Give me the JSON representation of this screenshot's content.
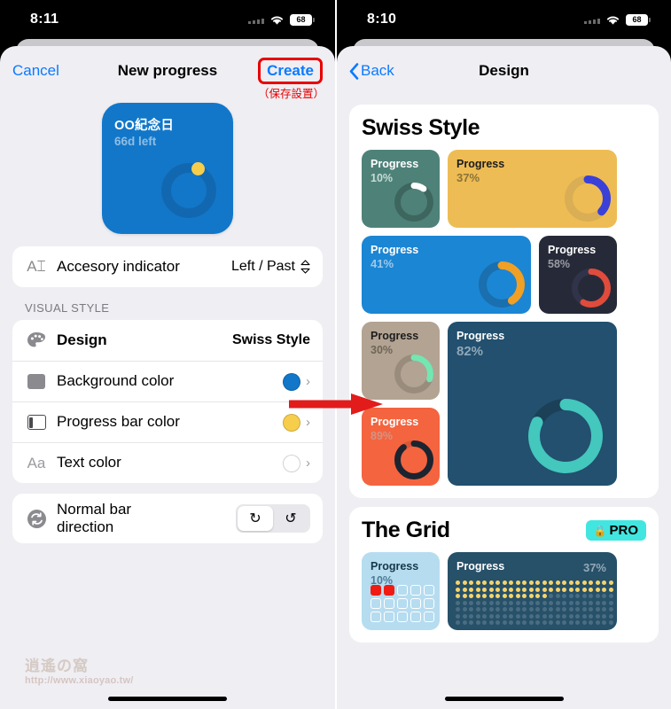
{
  "left_phone": {
    "status_bar": {
      "time": "8:11",
      "battery": "68",
      "wifi_icon": "wifi-icon",
      "signal_icon": "signal-dots-icon"
    },
    "nav": {
      "cancel_label": "Cancel",
      "title": "New progress",
      "create_label": "Create",
      "annotation": "（保存設置）"
    },
    "preview": {
      "title": "OO紀念日",
      "subtitle": "66d left"
    },
    "accessory_group": [
      {
        "icon": "text-cursor-icon",
        "label": "Accesory indicator",
        "value": "Left / Past",
        "control": "stepper-chevrons-icon"
      }
    ],
    "visual_style_header": "VISUAL STYLE",
    "visual_style_rows": [
      {
        "icon": "palette-icon",
        "label": "Design",
        "value": "Swiss Style",
        "chevron": "chevron-right-icon"
      },
      {
        "icon": "square-fill-icon",
        "label": "Background color",
        "swatch": "#1277c9",
        "chevron": "chevron-right-icon"
      },
      {
        "icon": "progress-bar-icon",
        "label": "Progress bar color",
        "swatch": "#f7ce4b",
        "chevron": "chevron-right-icon"
      },
      {
        "icon": "aa-text-icon",
        "label": "Text color",
        "swatch": "#ffffff",
        "chevron": "chevron-right-icon"
      }
    ],
    "direction_row": {
      "icon": "refresh-circle-icon",
      "label": "Normal bar direction",
      "options": [
        {
          "glyph": "↻",
          "name": "clockwise",
          "selected": true
        },
        {
          "glyph": "↺",
          "name": "counter-clockwise",
          "selected": false
        }
      ]
    },
    "watermark": {
      "badge": "逍遙の窩",
      "url": "http://www.xiaoyao.tw/"
    }
  },
  "right_phone": {
    "status_bar": {
      "time": "8:10",
      "battery": "68",
      "wifi_icon": "wifi-icon",
      "signal_icon": "signal-dots-icon"
    },
    "nav": {
      "back_label": "Back",
      "title": "Design"
    },
    "sections": [
      {
        "title": "Swiss Style",
        "pro": null,
        "tiles": [
          {
            "label": "Progress",
            "pct": "10%",
            "bg": "#4e8279",
            "text": "#ffffff",
            "sub": "#c6dcd6",
            "track": "#3d665f",
            "arc": "#ffffff",
            "value": 10,
            "size": "small"
          },
          {
            "label": "Progress",
            "pct": "37%",
            "bg": "#eebc54",
            "text": "#1c1c1e",
            "sub": "#8a7338",
            "track": "#d9ae55",
            "arc": "#3b40d8",
            "value": 37,
            "size": "wide"
          },
          {
            "label": "Progress",
            "pct": "41%",
            "bg": "#1b86d4",
            "text": "#ffffff",
            "sub": "#9ec8e8",
            "track": "#1a6fae",
            "arc": "#f0a024",
            "value": 41,
            "size": "wide"
          },
          {
            "label": "Progress",
            "pct": "58%",
            "bg": "#262a38",
            "text": "#ffffff",
            "sub": "#9a9ba4",
            "track": "#30344a",
            "arc": "#e04b3c",
            "value": 58,
            "size": "small"
          },
          {
            "label": "Progress",
            "pct": "30%",
            "bg": "#b3a392",
            "text": "#1c1c1e",
            "sub": "#6f6557",
            "track": "#9a8c7d",
            "arc": "#74e6b2",
            "value": 30,
            "size": "small"
          },
          {
            "label": "Progress",
            "pct": "89%",
            "bg": "#f4643f",
            "text": "#ffffff",
            "sub": "#d49282",
            "track": "#d9583a",
            "arc": "#1c2430",
            "value": 89,
            "size": "small"
          },
          {
            "label": "Progress",
            "pct": "82%",
            "bg": "#22506e",
            "text": "#ffffff",
            "sub": "#8fa8b9",
            "track": "#1b4058",
            "arc": "#44c7bd",
            "value": 82,
            "size": "big"
          }
        ]
      },
      {
        "title": "The Grid",
        "pro": "PRO",
        "pro_icon": "lock-icon",
        "tiles": [
          {
            "label": "Progress",
            "pct": "10%",
            "bg": "#b6dcf0",
            "text": "#17384a",
            "sub": "#4e7c94",
            "cells_total": 15,
            "cells_filled": 2,
            "cell_on": "#f01c13",
            "cell_off": "#b6dcf0",
            "cell_border": "#ffffff",
            "size": "small"
          },
          {
            "label": "Progress",
            "pct": "37%",
            "bg": "#275069",
            "text": "#ffffff",
            "sub": "#93a9b7",
            "dots_cols": 24,
            "dots_rows": 7,
            "dots_filled_pct": 37,
            "dot_on": "#f6d46b",
            "dot_off": "#4a6d82",
            "size": "wide"
          }
        ]
      }
    ]
  },
  "annotation_arrow": {
    "name": "red-arrow",
    "color": "#e21b1b"
  }
}
